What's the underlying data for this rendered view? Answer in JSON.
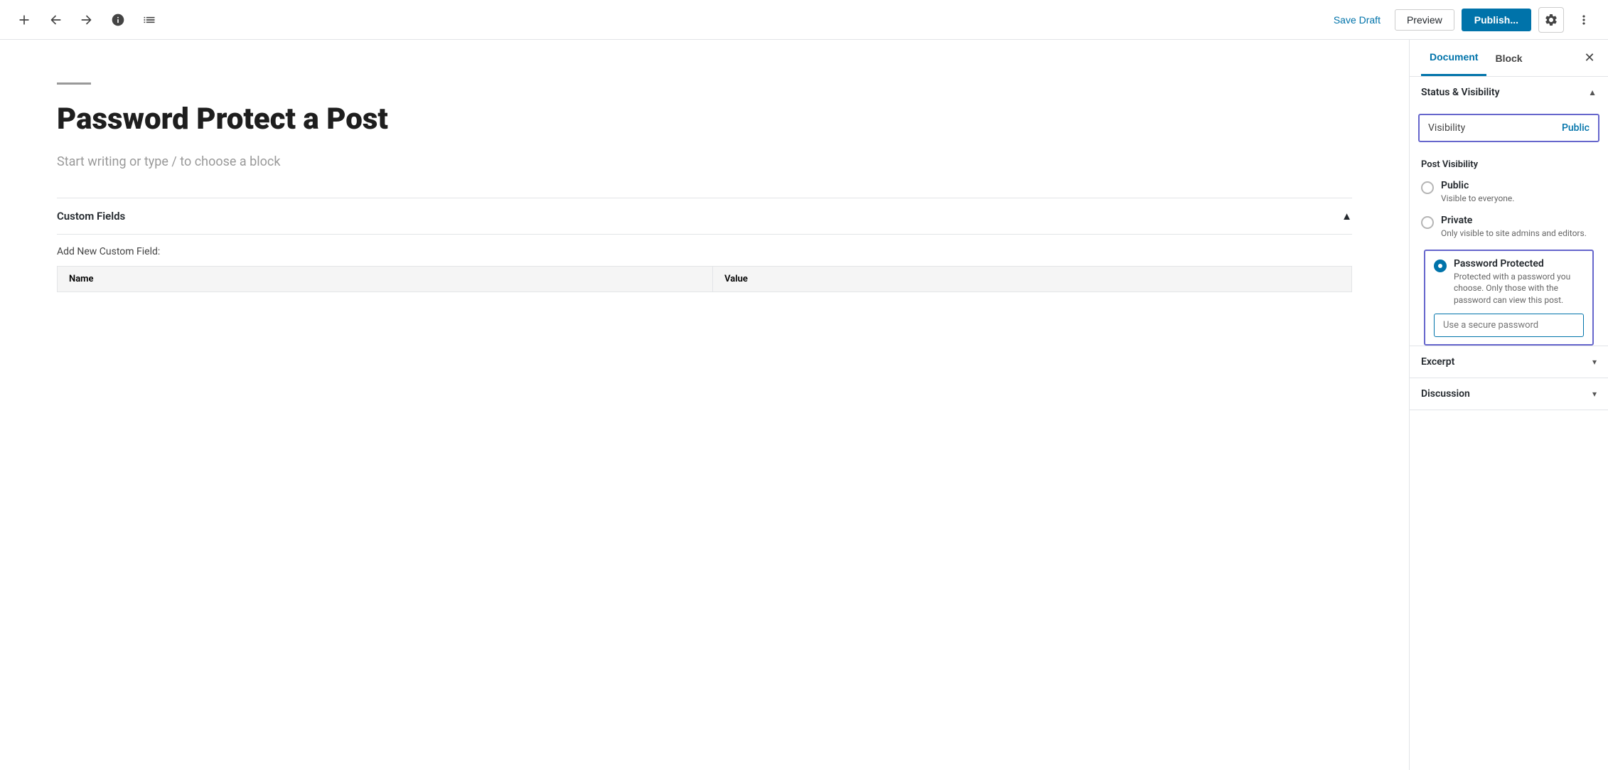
{
  "toolbar": {
    "save_draft_label": "Save Draft",
    "preview_label": "Preview",
    "publish_label": "Publish...",
    "document_tab": "Document",
    "block_tab": "Block"
  },
  "editor": {
    "title": "Password Protect a Post",
    "placeholder": "Start writing or type / to choose a block",
    "custom_fields": {
      "header": "Custom Fields",
      "add_label": "Add New Custom Field:",
      "col_name": "Name",
      "col_value": "Value"
    }
  },
  "sidebar": {
    "active_tab": "Document",
    "tabs": [
      "Document",
      "Block"
    ],
    "panels": {
      "status_visibility": {
        "title": "Status & Visibility",
        "visibility_label": "Visibility",
        "visibility_value": "Public",
        "post_visibility_title": "Post Visibility",
        "options": [
          {
            "label": "Public",
            "desc": "Visible to everyone.",
            "checked": false
          },
          {
            "label": "Private",
            "desc": "Only visible to site admins and editors.",
            "checked": false
          },
          {
            "label": "Password Protected",
            "desc": "Protected with a password you choose. Only those with the password can view this post.",
            "checked": true
          }
        ],
        "password_placeholder": "Use a secure password"
      },
      "excerpt": {
        "title": "Excerpt"
      },
      "discussion": {
        "title": "Discussion"
      }
    }
  }
}
